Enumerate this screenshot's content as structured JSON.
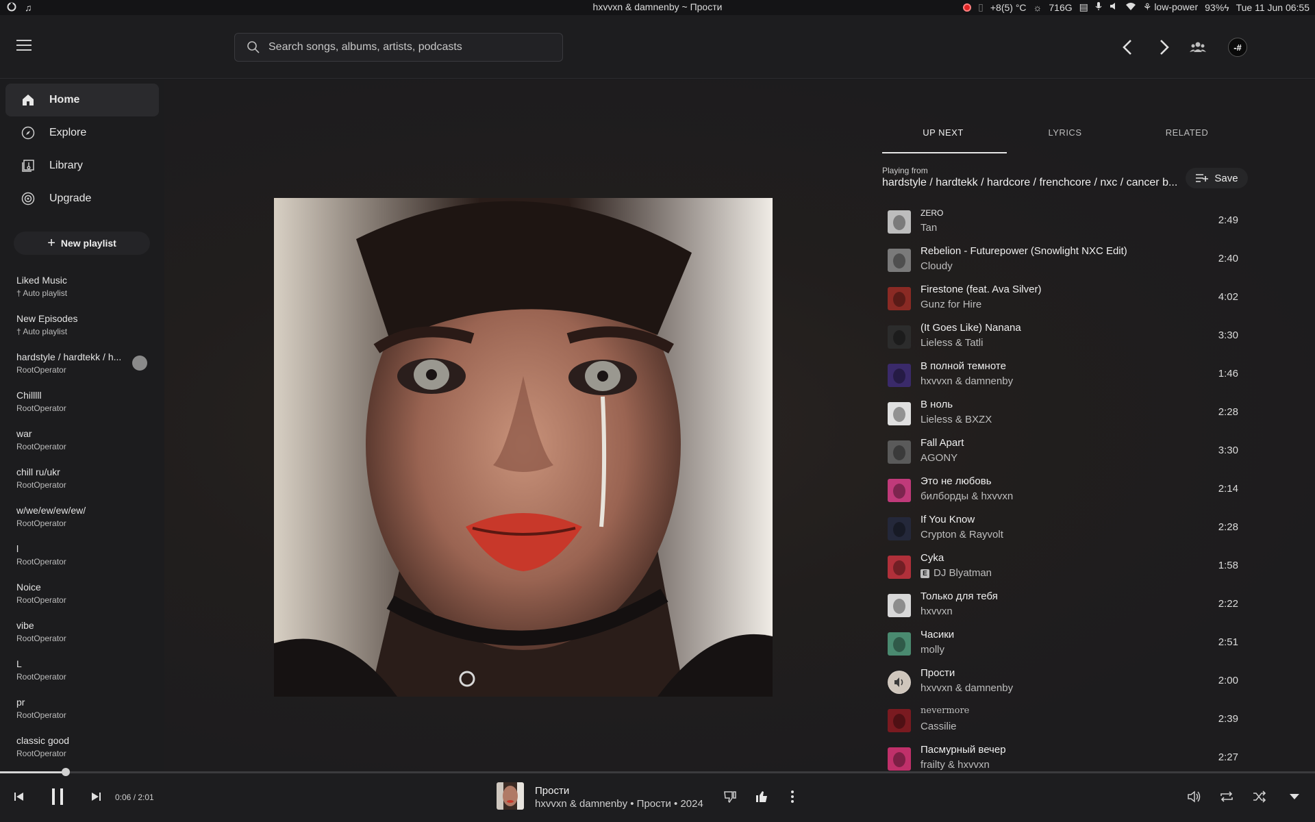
{
  "system_bar": {
    "window_title": "hxvvxn & damnenby ~ Прости",
    "temperature": "+8(5) °C",
    "disk": "716G",
    "power_mode": "low-power",
    "battery": "93%",
    "datetime": "Tue 11 Jun 06:55"
  },
  "header": {
    "search_placeholder": "Search songs, albums, artists, podcasts",
    "avatar_label": "-#"
  },
  "sidebar": {
    "nav": [
      {
        "label": "Home",
        "icon": "home-icon",
        "active": true
      },
      {
        "label": "Explore",
        "icon": "compass-icon",
        "active": false
      },
      {
        "label": "Library",
        "icon": "library-icon",
        "active": false
      },
      {
        "label": "Upgrade",
        "icon": "upgrade-icon",
        "active": false
      }
    ],
    "new_playlist_label": "New playlist",
    "playlists": [
      {
        "title": "Liked Music",
        "sub": "Auto playlist",
        "pinned": true
      },
      {
        "title": "New Episodes",
        "sub": "Auto playlist",
        "pinned": true
      },
      {
        "title": "hardstyle / hardtekk / h...",
        "sub": "RootOperator"
      },
      {
        "title": "Chilllll",
        "sub": "RootOperator"
      },
      {
        "title": "war",
        "sub": "RootOperator"
      },
      {
        "title": "chill ru/ukr",
        "sub": "RootOperator"
      },
      {
        "title": "w/we/ew/ew/ew/",
        "sub": "RootOperator"
      },
      {
        "title": "l",
        "sub": "RootOperator"
      },
      {
        "title": "Noice",
        "sub": "RootOperator"
      },
      {
        "title": "vibe",
        "sub": "RootOperator"
      },
      {
        "title": "L",
        "sub": "RootOperator"
      },
      {
        "title": "pr",
        "sub": "RootOperator"
      },
      {
        "title": "classic good",
        "sub": "RootOperator"
      }
    ]
  },
  "queue": {
    "tabs": [
      "UP NEXT",
      "LYRICS",
      "RELATED"
    ],
    "active_tab": "UP NEXT",
    "playing_from_label": "Playing from",
    "playing_from": "hardstyle / hardtekk / hardcore / frenchcore / nxc / cancer b...",
    "save_label": "Save",
    "items": [
      {
        "title": "ZERO",
        "artist": "Tan",
        "duration": "2:49",
        "thumb": "#bdbdbd"
      },
      {
        "title": "Rebelion - Futurepower (Snowlight NXC Edit)",
        "artist": "Cloudy",
        "duration": "2:40",
        "thumb": "#7a7a7a"
      },
      {
        "title": "Firestone (feat. Ava Silver)",
        "artist": "Gunz for Hire",
        "duration": "4:02",
        "thumb": "#8a2a24"
      },
      {
        "title": "(It Goes Like) Nanana",
        "artist": "Lieless & Tatli",
        "duration": "3:30",
        "thumb": "#2c2c2c"
      },
      {
        "title": "В полной темноте",
        "artist": "hxvvxn & damnenby",
        "duration": "1:46",
        "thumb": "#3a2a6a"
      },
      {
        "title": "В ноль",
        "artist": "Lieless & BXZX",
        "duration": "2:28",
        "thumb": "#e0e0e0"
      },
      {
        "title": "Fall Apart",
        "artist": "AGONY",
        "duration": "3:30",
        "thumb": "#5a5a5a"
      },
      {
        "title": "Это не любовь",
        "artist": "билборды & hxvvxn",
        "duration": "2:14",
        "thumb": "#c03a7a"
      },
      {
        "title": "If You Know",
        "artist": "Crypton & Rayvolt",
        "duration": "2:28",
        "thumb": "#24283a"
      },
      {
        "title": "Cyka",
        "artist": "DJ Blyatman",
        "duration": "1:58",
        "thumb": "#b0303a",
        "explicit": true
      },
      {
        "title": "Только для тебя",
        "artist": "hxvvxn",
        "duration": "2:22",
        "thumb": "#d8d8d8"
      },
      {
        "title": "Часики",
        "artist": "molly",
        "duration": "2:51",
        "thumb": "#4a8a70"
      },
      {
        "title": "Прости",
        "artist": "hxvvxn & damnenby",
        "duration": "2:00",
        "thumb": "#d8d0c8",
        "playing": true
      },
      {
        "title": "nevermore",
        "artist": "Cassilie",
        "duration": "2:39",
        "thumb": "#7a1a20"
      },
      {
        "title": "Пасмурный вечер",
        "artist": "frailty & hxvvxn",
        "duration": "2:27",
        "thumb": "#c0306a"
      }
    ]
  },
  "player": {
    "time": "0:06 / 2:01",
    "progress": 0.05,
    "now_playing_title": "Прости",
    "now_playing_sub": "hxvvxn & damnenby • Прости • 2024"
  }
}
